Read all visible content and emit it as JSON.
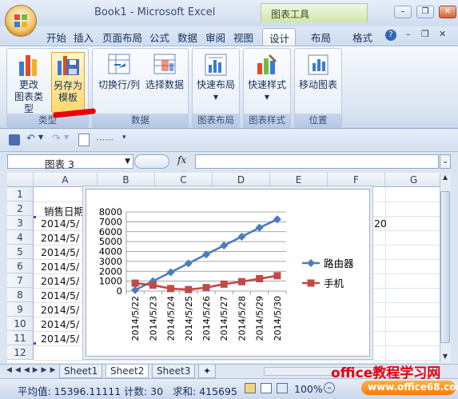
{
  "window": {
    "title": "Book1 - Microsoft Excel",
    "context_tab": "图表工具",
    "controls": [
      "minimize",
      "restore",
      "close"
    ]
  },
  "ribbon_tabs": [
    "开始",
    "插入",
    "页面布局",
    "公式",
    "数据",
    "审阅",
    "视图",
    "设计",
    "布局",
    "格式"
  ],
  "active_tab": "设计",
  "ribbon": {
    "groups": [
      {
        "label": "类型",
        "buttons": [
          "更改\n图表类型",
          "另存为\n模板"
        ]
      },
      {
        "label": "数据",
        "buttons": [
          "切换行/列",
          "选择数据"
        ]
      },
      {
        "label": "图表布局",
        "buttons": [
          "快速布局"
        ]
      },
      {
        "label": "图表样式",
        "buttons": [
          "快速样式"
        ]
      },
      {
        "label": "位置",
        "buttons": [
          "移动图表"
        ]
      }
    ],
    "change_type_l1": "更改",
    "change_type_l2": "图表类型",
    "save_template_l1": "另存为",
    "save_template_l2": "模板",
    "switch_rowcol": "切换行/列",
    "select_data": "选择数据",
    "quick_layout": "快速布局",
    "quick_style": "快速样式",
    "move_chart": "移动图表",
    "g_type": "类型",
    "g_data": "数据",
    "g_layout": "图表布局",
    "g_style": "图表样式",
    "g_location": "位置"
  },
  "formula_bar": {
    "name_box": "图表 3",
    "fx": "fx",
    "value": ""
  },
  "columns": [
    "A",
    "B",
    "C",
    "D",
    "E",
    "F",
    "G"
  ],
  "rows": [
    "1",
    "2",
    "3",
    "4",
    "5",
    "6",
    "7",
    "8",
    "9",
    "10",
    "11",
    "12"
  ],
  "cells": {
    "a2": "销售日期",
    "a3": "2014/5/",
    "a4": "2014/5/",
    "a5": "2014/5/",
    "a6": "2014/5/",
    "a7": "2014/5/",
    "a8": "2014/5/",
    "a9": "2014/5/",
    "a10": "2014/5/",
    "a11": "2014/5/",
    "f3": "020"
  },
  "chart_data": {
    "type": "line",
    "categories": [
      "2014/5/22",
      "2014/5/23",
      "2014/5/24",
      "2014/5/25",
      "2014/5/26",
      "2014/5/27",
      "2014/5/28",
      "2014/5/29",
      "2014/5/30"
    ],
    "series": [
      {
        "name": "路由器",
        "color": "#4a7ebb",
        "marker": "diamond",
        "values": [
          100,
          1000,
          1900,
          2800,
          3700,
          4600,
          5500,
          6400,
          7250
        ]
      },
      {
        "name": "手机",
        "color": "#be4b48",
        "marker": "square",
        "values": [
          800,
          600,
          250,
          150,
          350,
          700,
          950,
          1250,
          1550
        ]
      }
    ],
    "yticks": [
      "0",
      "1000",
      "2000",
      "3000",
      "4000",
      "5000",
      "6000",
      "7000",
      "8000"
    ],
    "ylim": [
      0,
      8000
    ],
    "legend_position": "right",
    "grid": "horizontal"
  },
  "sheets": [
    "Sheet1",
    "Sheet2",
    "Sheet3"
  ],
  "active_sheet": "Sheet2",
  "status": {
    "average": "平均值: 15396.11111",
    "count": "计数: 30",
    "sum": "求和: 415695",
    "zoom": "100%"
  },
  "watermark": {
    "line1": "office教程学习网",
    "line2": "www.office68.com"
  }
}
